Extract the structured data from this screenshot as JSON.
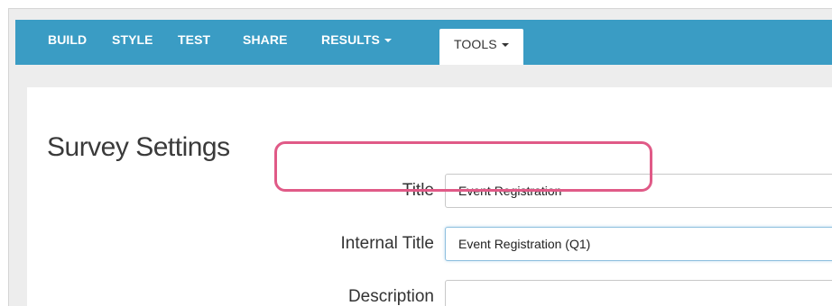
{
  "nav": {
    "items": [
      {
        "label": "BUILD"
      },
      {
        "label": "STYLE"
      },
      {
        "label": "TEST"
      },
      {
        "label": "SHARE"
      },
      {
        "label": "RESULTS"
      },
      {
        "label": "TOOLS"
      }
    ],
    "active": "TOOLS",
    "color": "#3a9cc4"
  },
  "page": {
    "title": "Survey Settings"
  },
  "form": {
    "title_label": "Title",
    "title_value": "Event Registration",
    "internal_title_label": "Internal Title",
    "internal_title_value": "Event Registration (Q1)",
    "description_label": "Description",
    "description_value": ""
  },
  "highlight": {
    "color": "#e05a87"
  }
}
